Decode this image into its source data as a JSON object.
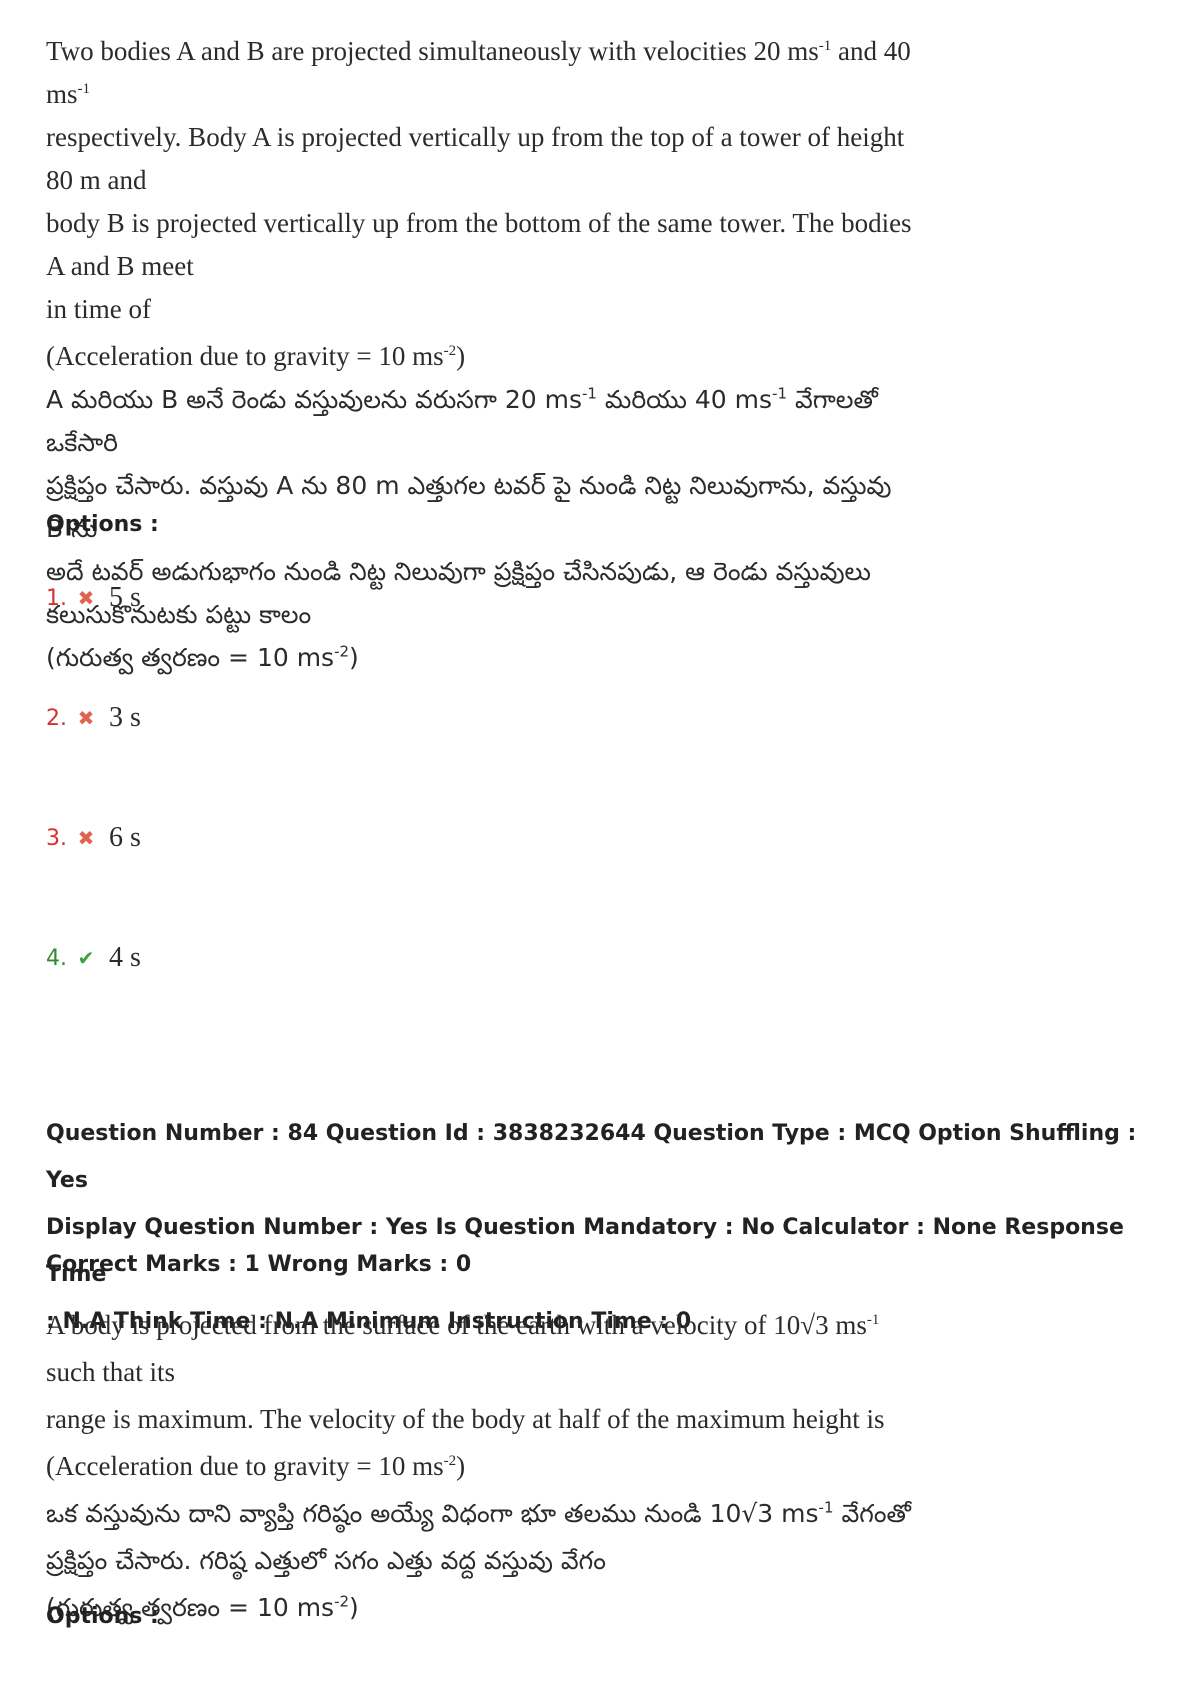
{
  "question_prev": {
    "en_line1": "Two bodies A and B are projected simultaneously with velocities 20 ms",
    "en_sup1": "-1",
    "en_line1b": " and 40 ms",
    "en_sup1b": "-1",
    "en_line2": "respectively. Body A is projected vertically up from the top of a tower of height 80 m and",
    "en_line3": "body B is projected vertically up from the bottom of the same tower. The bodies A and B meet",
    "en_line4": "in time of",
    "en_gravity": "(Acceleration due to gravity = 10 ms",
    "en_gravity_sup": "-2",
    "en_gravity_end": ")",
    "te_line1": "A మరియు B అనే రెండు వస్తువులను వరుసగా 20 ms",
    "te_sup1": "-1",
    "te_line1b": " మరియు 40 ms",
    "te_sup1b": "-1",
    "te_line1c": " వేగాలతో ఒకేసారి",
    "te_line2": "ప్రక్షిప్తం చేసారు. వస్తువు A ను 80 m ఎత్తుగల టవర్ పై నుండి నిట్ట నిలువుగాను, వస్తువు B ను",
    "te_line3": "అదే టవర్ అడుగుభాగం నుండి నిట్ట నిలువుగా ప్రక్షిప్తం చేసినపుడు, ఆ రెండు వస్తువులు",
    "te_line4": "కలుసుకొనుటకు పట్టు కాలం",
    "te_gravity": "(గురుత్వ త్వరణం = 10 ms",
    "te_gravity_sup": "-2",
    "te_gravity_end": ")"
  },
  "options_label": "Options :",
  "options": [
    {
      "num": "1.",
      "status": "wrong",
      "icon": "cross-icon",
      "text": "5 s"
    },
    {
      "num": "2.",
      "status": "wrong",
      "icon": "cross-icon",
      "text": "3 s"
    },
    {
      "num": "3.",
      "status": "wrong",
      "icon": "cross-icon",
      "text": "6 s"
    },
    {
      "num": "4.",
      "status": "correct",
      "icon": "check-icon",
      "text": "4 s"
    }
  ],
  "meta": {
    "line1": "Question Number : 84 Question Id : 3838232644 Question Type : MCQ Option Shuffling : Yes",
    "line2": "Display Question Number : Yes Is Question Mandatory : No Calculator : None Response Time",
    "line3": ": N.A Think Time : N.A Minimum Instruction Time : 0"
  },
  "marks": "Correct Marks : 1 Wrong Marks : 0",
  "question_next": {
    "en_line1a": "A body is projected from the surface of the earth with a velocity of 10√3 ms",
    "en_sup1": "-1",
    "en_line1b": " such that its",
    "en_line2": "range is maximum. The velocity of the body at half of the maximum height is",
    "en_gravity": "(Acceleration due to gravity = 10 ms",
    "en_gravity_sup": "-2",
    "en_gravity_end": ")",
    "te_line1a": "ఒక వస్తువును దాని వ్యాప్తి గరిష్ఠం అయ్యే విధంగా భూ తలము నుండి 10√3 ms",
    "te_sup1": "-1",
    "te_line1b": " వేగంతో",
    "te_line2": "ప్రక్షిప్తం చేసారు. గరిష్ఠ ఎత్తులో సగం ఎత్తు వద్ద వస్తువు వేగం",
    "te_gravity": "(గురుత్వ త్వరణం = 10 ms",
    "te_gravity_sup": "-2",
    "te_gravity_end": ")"
  },
  "options_label_2": "Options :",
  "colors": {
    "wrong": "#d9302c",
    "correct": "#2e8b2e"
  }
}
